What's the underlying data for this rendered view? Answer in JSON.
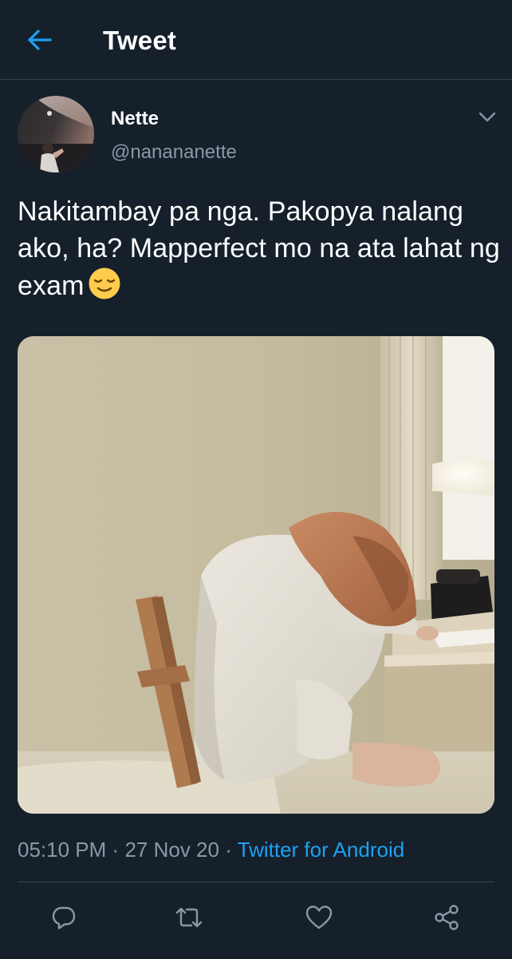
{
  "header": {
    "title": "Tweet",
    "back_icon": "arrow-left-icon"
  },
  "tweet": {
    "author": {
      "name": "Nette",
      "handle": "@nanananette"
    },
    "text": "Nakitambay pa nga. Pakopya nalang ako, ha? Mapperfect mo na ata lahat ng exam",
    "emoji": "relieved-face-emoji",
    "time": "05:10 PM",
    "separator": "·",
    "date": "27 Nov 20",
    "source": "Twitter for Android"
  },
  "actions": [
    {
      "icon": "reply-icon"
    },
    {
      "icon": "retweet-icon"
    },
    {
      "icon": "like-icon"
    },
    {
      "icon": "share-icon"
    }
  ],
  "colors": {
    "background": "#15202b",
    "border": "#38444d",
    "accent": "#1da1f2",
    "secondary_text": "#8899a6",
    "primary_text": "#ffffff"
  }
}
